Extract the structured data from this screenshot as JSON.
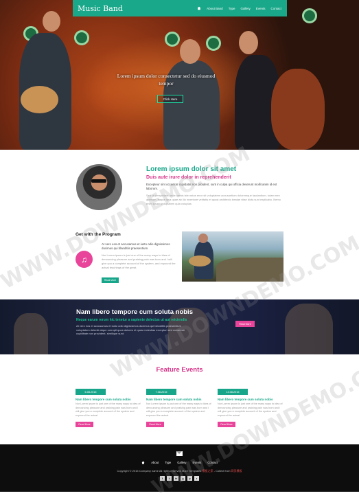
{
  "nav": {
    "brand": "Music Band",
    "links": [
      "About Band",
      "Type",
      "Gallery",
      "Events",
      "Contact"
    ]
  },
  "hero": {
    "caption": "Lorem ipsum dolor consectetur sed do eiusmod tempor",
    "button": "Click Here"
  },
  "about": {
    "title": "Lorem ipsum dolor sit amet",
    "subtitle": "Duis aute irure dolor in reprehenderit",
    "p1": "Excepteur sint occaecat cupidatat non proident, sunt in culpa qui officia deserunt mollit anim id est laborum.",
    "p2": "Sed ut perspiciatis unde omnis iste natus error sit voluptatem accusantium doloremque laudantium, totam rem aperiam, eaque ipsa quae ab illo inventore veritatis et quasi architecto beatae vitae dicta sunt explicabo. Nemo enim ipsam voluptatem quia voluptas"
  },
  "program": {
    "title": "Get with the Program",
    "p1": "At vero eos et accusamus et iusto odio dignissimos ducimus qui blanditiis praesentium.",
    "p2": "Nor Lorem ipsum is just one of the many ways to idea of denouncing pleasure and praising pain was born and I will give you a complete account of the system, and expound the actual teachings of the great.",
    "button": "Read More"
  },
  "band": {
    "title": "Nam libero tempore cum soluta nobis",
    "subtitle": "Neque earum rerum hic tenetur a sapiente delectus ut aut reiciendis",
    "text": "At vero eos et accusamus et iusto odio dignissimos ducimus qui blanditiis praesentium voluptatum deleniti atque corrupti quos dolores et quas molestias excepturi sint occaecati cupiditate non provident, similique sunt.",
    "button": "Read More"
  },
  "events": {
    "title": "Feature Events",
    "items": [
      {
        "date": "6.08.2015",
        "title": "Nam libero tempore cum soluta nobis",
        "text": "Nor Lorem ipsum is just one of the many ways to idea of denouncing pleasure and praising pain was born and I will give you a complete account of the system and expound the actual.",
        "button": "Read More"
      },
      {
        "date": "7.08.2015",
        "title": "Nam libero tempore cum soluta nobis",
        "text": "Nor Lorem ipsum is just one of the many ways to idea of denouncing pleasure and praising pain was born and I will give you a complete account of the system and expound the actual.",
        "button": "Read More"
      },
      {
        "date": "13.08.2015",
        "title": "Nam libero tempore cum soluta nobis",
        "text": "Nor Lorem ipsum is just one of the many ways to idea of denouncing pleasure and praising pain was born and I will give you a complete account of the system and expound the actual.",
        "button": "Read More"
      }
    ]
  },
  "footer": {
    "links": [
      "About",
      "Type",
      "Gallery",
      "Events",
      "Contact"
    ],
    "copyright": "Copyright © 2015 Company name All rights reserved More Templates",
    "copyright_link1": "模板之家",
    "collect": " - Collect from ",
    "copyright_link2": "网页模板",
    "socials": [
      "f",
      "t",
      "in",
      "g",
      "p",
      "r"
    ]
  },
  "watermark": "WWW.DOWNDEMO.COM",
  "colors": {
    "accent": "#18a68a",
    "pink": "#d6338a",
    "dark": "#0d0d0d"
  }
}
